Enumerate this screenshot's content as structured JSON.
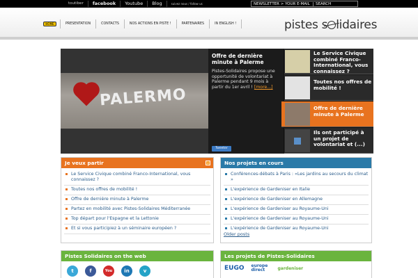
{
  "topbar": {
    "social": [
      "toutiber",
      "facebook",
      "Youtube",
      "Blog",
      "suivez nous / follow us"
    ],
    "newsletter_label": "NEWSLETTER > YOUR E-MAIL",
    "search_label": "SEARCH"
  },
  "header": {
    "home_label": "HOME",
    "nav": [
      "PRESENTATION",
      "CONTACTS",
      "NOS ACTIONS EN PISTE !",
      "PARTENAIRES",
      "IN ENGLISH !"
    ],
    "logo_left": "pistes s",
    "logo_right": "lidaires"
  },
  "slider": {
    "photo_text": "PALERMO",
    "caption_title": "Offre de dernière minute à Palerme",
    "caption_text": "Pistes-Solidaires propose une opportunité de volontariat à Palerme pendant 9 mois à partir du 1er avril !",
    "caption_more": "[more...]",
    "tweet_label": "Tweeter",
    "tabs": [
      {
        "title": "Le Service Civique combiné Franco-International, vous connaissez ?"
      },
      {
        "title": "Toutes nos offres de mobilité !"
      },
      {
        "title": "Offre de dernière minute à Palerme"
      },
      {
        "title": "Ils ont participé à un projet de volontariat et (...)"
      }
    ]
  },
  "je_veux_partir": {
    "title": "Je veux partir",
    "items": [
      "Le Service Civique combiné Franco-International, vous connaissez ?",
      "Toutes nos offres de mobilité !",
      "Offre de dernière minute à Palerme",
      "Partez en mobilité avec Pistes-Solidaires Méditerranée",
      "Top départ pour l'Espagne et la Lettonie",
      "Et si vous participiez à un séminaire européen ?"
    ]
  },
  "projets": {
    "title": "Nos projets en cours",
    "items": [
      "Conférences-débats à Paris : «Les jardins au secours du climat »",
      "L'expérience de Gardeniser en Italie",
      "L'expérience de Gardeniser en Allemagne",
      "L'expérience de Gardeniser au Royaume-Uni",
      "L'expérience de Gardeniser au Royaume-Uni",
      "L'expérience de Gardeniser au Royaume-Uni"
    ],
    "older": "Older posts"
  },
  "web": {
    "title": "Pistes Solidaires on the web",
    "icons": [
      "t",
      "f",
      "You",
      "in",
      "v"
    ]
  },
  "partners": {
    "title": "Les projets de Pistes-Solidaires",
    "logos": [
      "EUGO",
      "europe direct",
      "gardeniser"
    ]
  },
  "colors": {
    "orange": "#e8731f",
    "blue": "#2a7aa8",
    "green": "#6ab43e",
    "yellow": "#f2c200"
  }
}
